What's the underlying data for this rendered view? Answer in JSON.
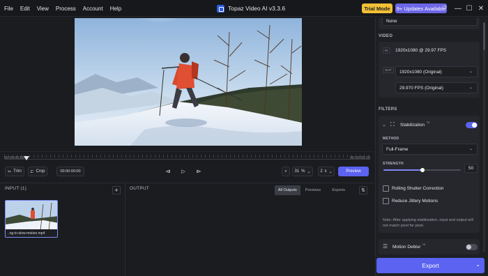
{
  "menu": [
    "File",
    "Edit",
    "View",
    "Process",
    "Account",
    "Help"
  ],
  "app_title": "Topaz Video AI  v3.3.6",
  "trial_label": "Trial Mode",
  "updates_label": "9+ Updates Available",
  "window_controls": {
    "help": "?",
    "minimize": "—",
    "maximize": "☐",
    "close": "✕"
  },
  "timeline": {
    "start_tc": "00:00:00:00",
    "end_tc": "00:00:06:20",
    "playhead_fraction": 0.06
  },
  "toolbar": {
    "trim": "Trim",
    "crop": "Crop",
    "timecode": "00:00:00:00",
    "zoom": "31",
    "zoom_unit": "%",
    "speed": "2",
    "speed_unit": "x",
    "preview": "Preview"
  },
  "input_panel": {
    "title": "INPUT (1)",
    "add": "+",
    "thumb_label": "..ng-in-slow-motion.mp4"
  },
  "output_panel": {
    "title": "OUTPUT",
    "tabs": [
      "All Outputs",
      "Previews",
      "Exports"
    ],
    "active_tab": 0,
    "sort": "⇅"
  },
  "right_panel": {
    "top_dropdown": "None",
    "video_heading": "VIDEO",
    "in_tag": "IN",
    "in_info": "1920x1080 @ 29.97 FPS",
    "out_tag": "OUT",
    "resolution": "1920x1080 (Original)",
    "fps": "29.970 FPS (Original)",
    "filters_heading": "FILTERS",
    "stabilization": {
      "title": "Stabilization",
      "ai_tag": "AI",
      "enabled": true
    },
    "method_label": "METHOD",
    "method_value": "Full-Frame",
    "strength_label": "STRENGTH",
    "strength_value": "50",
    "strength_fraction": 0.5,
    "rolling_shutter": "Rolling Shutter Correction",
    "reduce_jitter": "Reduce Jittery Motions",
    "note": "Note: After applying stabilization, input and output will not match pixel for pixel.",
    "motion_deblur": {
      "title": "Motion Deblur",
      "ai_tag": "AI",
      "enabled": false
    },
    "export": "Export"
  },
  "colors": {
    "accent": "#5b63f0",
    "trial": "#f2c037",
    "updates": "#6d66e8",
    "background": "#1b1c20"
  }
}
